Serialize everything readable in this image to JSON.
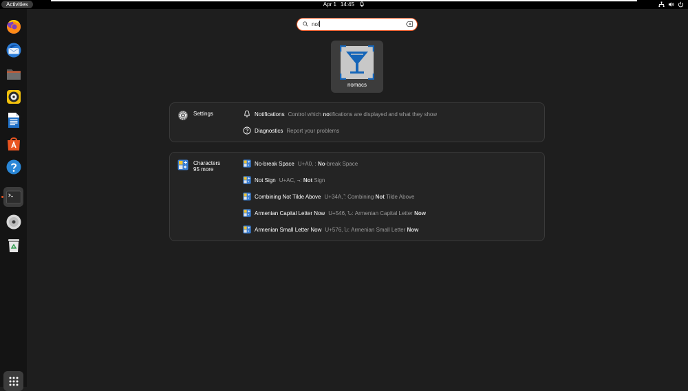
{
  "topbar": {
    "activities": "Activities",
    "date": "Apr 1",
    "time": "14:45"
  },
  "dock": {
    "apps": [
      {
        "name": "firefox",
        "icon": "firefox-icon"
      },
      {
        "name": "thunderbird",
        "icon": "thunderbird-icon"
      },
      {
        "name": "files",
        "icon": "files-icon"
      },
      {
        "name": "rhythmbox",
        "icon": "rhythmbox-icon"
      },
      {
        "name": "libreoffice-writer",
        "icon": "writer-icon"
      },
      {
        "name": "app-center",
        "icon": "app-center-icon"
      },
      {
        "name": "help",
        "icon": "help-icon"
      },
      {
        "name": "terminal",
        "icon": "terminal-icon",
        "running": true
      },
      {
        "name": "disc",
        "icon": "disc-icon"
      },
      {
        "name": "trash",
        "icon": "trash-icon"
      }
    ],
    "show_apps_icon": "grid-icon"
  },
  "search": {
    "value": "nol"
  },
  "app_result": {
    "label": "nomacs",
    "icon": "nomacs-icon"
  },
  "settings_panel": {
    "provider": "Settings",
    "results": [
      {
        "title": "Notifications",
        "desc_pre": "Control which ",
        "desc_match": "no",
        "desc_post": "tifications are displayed and what they show",
        "icon": "bell-icon"
      },
      {
        "title": "Diagnostics",
        "desc_pre": "Report your problems",
        "desc_match": "",
        "desc_post": "",
        "icon": "help-circle-icon"
      }
    ]
  },
  "characters_panel": {
    "provider": "Characters",
    "more": "95 more",
    "results": [
      {
        "title": "No-break Space",
        "desc_pre": "U+A0,   : ",
        "desc_match": "No",
        "desc_post": "-break Space"
      },
      {
        "title": "Not Sign",
        "desc_pre": "U+AC, ¬: ",
        "desc_match": "Not",
        "desc_post": " Sign"
      },
      {
        "title": "Combining Not Tilde Above",
        "desc_pre": "U+34A, ͊: Combining ",
        "desc_match": "Not",
        "desc_post": " Tilde Above"
      },
      {
        "title": "Armenian Capital Letter Now",
        "desc_pre": "U+546, Ն: Armenian Capital Letter ",
        "desc_match": "Now",
        "desc_post": ""
      },
      {
        "title": "Armenian Small Letter Now",
        "desc_pre": "U+576, ն: Armenian Small Letter ",
        "desc_match": "Now",
        "desc_post": ""
      }
    ]
  },
  "colors": {
    "accent": "#e95420",
    "background": "#1e1e1e",
    "panel": "#242424"
  }
}
